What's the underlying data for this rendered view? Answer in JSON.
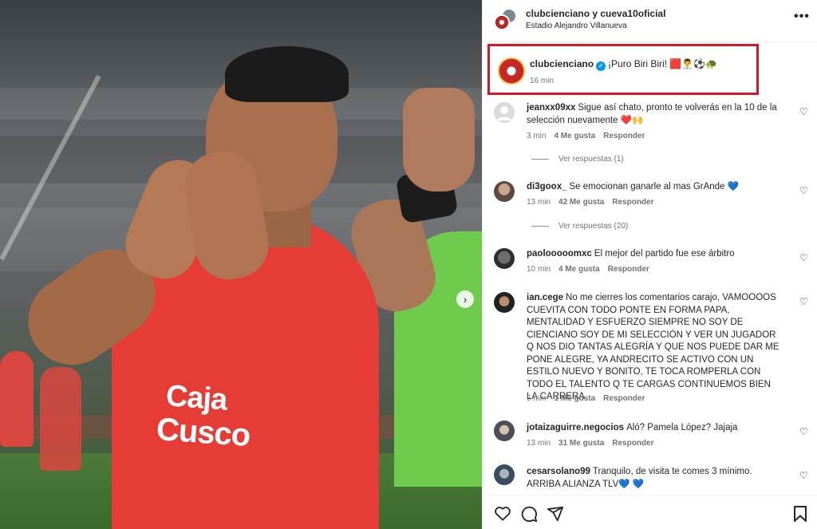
{
  "photo": {
    "sponsor_line1": "Caja",
    "sponsor_line2": "Cusco",
    "next_icon": "chevron-right-icon"
  },
  "header": {
    "title": "clubcienciano y cueva10oficial",
    "location": "Estadio Alejandro Villanueva",
    "more_icon": "more-horizontal-icon"
  },
  "caption": {
    "username": "clubcienciano",
    "text": "¡Puro Biri Biri! 🟥👨‍💼⚽🐢",
    "time": "16 min",
    "highlight_color": "#d1192a"
  },
  "comments": [
    {
      "username": "jeanxx09xx",
      "text": "Sigue así chato, pronto te volverás en la 10 de la selección nuevamente ❤️🙌",
      "time": "3 min",
      "likes": "4 Me gusta",
      "reply": "Responder",
      "view_replies": "Ver respuestas (1)"
    },
    {
      "username": "di3goox_",
      "text": "Se emocionan ganarle al mas GrAnde 💙",
      "time": "13 min",
      "likes": "42 Me gusta",
      "reply": "Responder",
      "view_replies": "Ver respuestas (20)"
    },
    {
      "username": "paolooooomxc",
      "text": "El mejor del partido fue ese árbitro",
      "time": "10 min",
      "likes": "4 Me gusta",
      "reply": "Responder"
    },
    {
      "username": "ian.cege",
      "text": "No me cierres los comentarios carajo, VAMOOOOS CUEVITA CON TODO PONTE EN FORMA PAPA, MENTALIDAD Y ESFUERZO SIEMPRE NO SOY DE CIENCIANO SOY DE MI SELECCIÓN Y VER UN JUGADOR Q NOS DIO TANTAS ALEGRÍA Y QUE NOS PUEDE DAR ME PONE ALEGRE, YA ANDRECITO SE ACTIVO CON UN ESTILO NUEVO Y BONITO, TE TOCA ROMPERLA CON TODO EL TALENTO Q TE CARGAS CONTINUEMOS BIEN LA CARRERA",
      "time": "5 min",
      "likes": "1 Me gusta",
      "reply": "Responder"
    },
    {
      "username": "jotaizaguirre.negocios",
      "text": "Aló? Pamela López? Jajaja",
      "time": "13 min",
      "likes": "31 Me gusta",
      "reply": "Responder"
    },
    {
      "username": "cesarsolano99",
      "text": "Tranquilo, de visita te comes 3 mínimo. ARRIBA ALIANZA TLV💙 💙"
    }
  ],
  "actions": {
    "like_icon": "heart-icon",
    "comment_icon": "comment-icon",
    "share_icon": "send-icon",
    "save_icon": "bookmark-icon"
  }
}
